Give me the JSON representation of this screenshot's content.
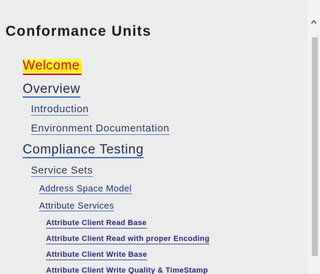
{
  "panel": {
    "title": "Conformance Units"
  },
  "nav": {
    "welcome": "Welcome",
    "overview": "Overview",
    "introduction": "Introduction",
    "environment_documentation": "Environment Documentation",
    "compliance_testing": "Compliance Testing",
    "service_sets": "Service Sets",
    "address_space_model": "Address Space Model",
    "attribute_services": "Attribute Services",
    "attribute_client_read_base": "Attribute Client Read Base",
    "attribute_client_read_encoding": "Attribute Client Read with proper Encoding",
    "attribute_client_write_base": "Attribute Client Write Base",
    "attribute_client_write_quality": "Attribute Client Write Quality & TimeStamp"
  },
  "scrollbar": {
    "up_icon": "chevron-up-icon"
  },
  "colors": {
    "background": "#ececec",
    "welcome_highlight": "#ffee00",
    "welcome_text": "#c8102e",
    "link_underline": "#4a74c4"
  }
}
